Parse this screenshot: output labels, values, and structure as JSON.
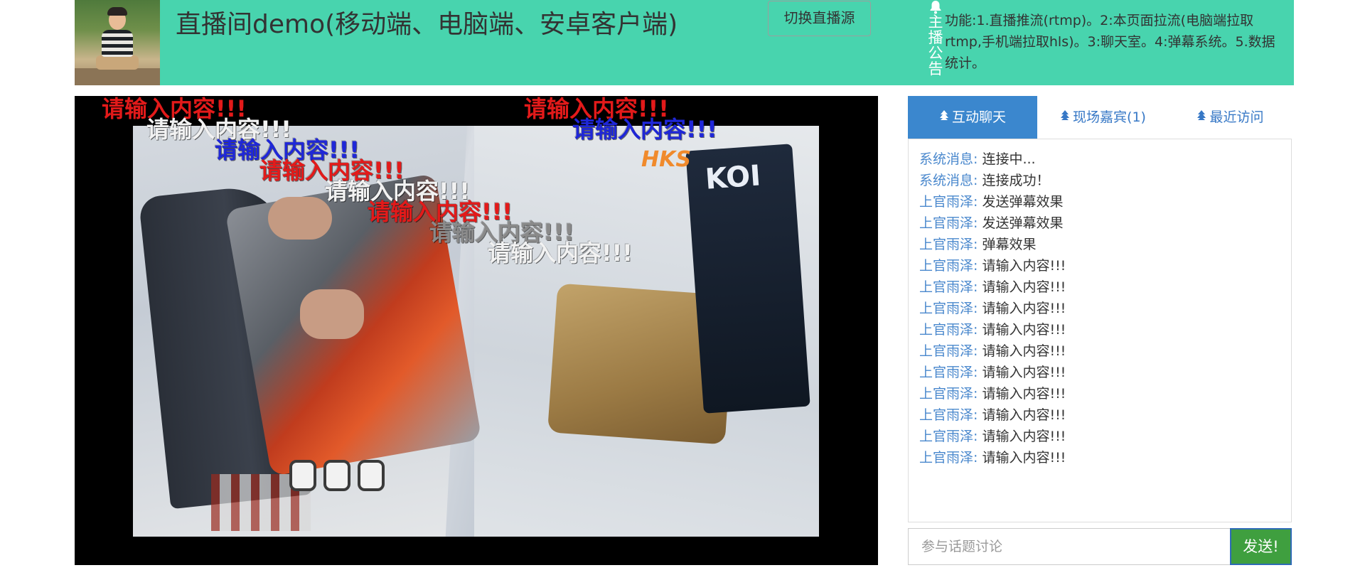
{
  "header": {
    "title": "直播间demo(移动端、电脑端、安卓客户端)",
    "switch_source_label": "切换直播源",
    "notice_label": "主播公告",
    "notice_text": "功能:1.直播推流(rtmp)。2:本页面拉流(电脑端拉取rtmp,手机端拉取hls)。3:聊天室。4:弹幕系统。5.数据统计。"
  },
  "colors": {
    "header_bg": "#48d4ae",
    "active_tab_bg": "#3b87ce",
    "link_blue": "#4a88cd",
    "send_button_bg": "#3f9f3f"
  },
  "video": {
    "danmu": [
      {
        "text": "请输入内容!!!",
        "color": "#e31a1a"
      },
      {
        "text": "请输入内容!!!",
        "color": "#e31a1a"
      },
      {
        "text": "请输入内容!!!",
        "color": "#f2f2f2"
      },
      {
        "text": "请输入内容!!!",
        "color": "#1f27d8"
      },
      {
        "text": "请输入内容!!!",
        "color": "#1f27d8"
      },
      {
        "text": "请输入内容!!!",
        "color": "#e31a1a"
      },
      {
        "text": "请输入内容!!!",
        "color": "#f2f2f2"
      },
      {
        "text": "请输入内容!!!",
        "color": "#e31a1a"
      },
      {
        "text": "请输入内容!!!",
        "color": "#8a8a8a"
      },
      {
        "text": "请输入内容!!!",
        "color": "#f2f2f2"
      }
    ],
    "frame_logo": "HKS",
    "frame_ad_text": "KOI"
  },
  "chat": {
    "tabs": [
      {
        "label": "互动聊天",
        "active": true
      },
      {
        "label": "现场嘉宾(1)",
        "active": false
      },
      {
        "label": "最近访问",
        "active": false
      }
    ],
    "messages": [
      {
        "user": "系统消息:",
        "text": "连接中..."
      },
      {
        "user": "系统消息:",
        "text": "连接成功！"
      },
      {
        "user": "上官雨泽:",
        "text": "发送弹幕效果"
      },
      {
        "user": "上官雨泽:",
        "text": "发送弹幕效果"
      },
      {
        "user": "上官雨泽:",
        "text": "弹幕效果"
      },
      {
        "user": "上官雨泽:",
        "text": "请输入内容!!!"
      },
      {
        "user": "上官雨泽:",
        "text": "请输入内容!!!"
      },
      {
        "user": "上官雨泽:",
        "text": "请输入内容!!!"
      },
      {
        "user": "上官雨泽:",
        "text": "请输入内容!!!"
      },
      {
        "user": "上官雨泽:",
        "text": "请输入内容!!!"
      },
      {
        "user": "上官雨泽:",
        "text": "请输入内容!!!"
      },
      {
        "user": "上官雨泽:",
        "text": "请输入内容!!!"
      },
      {
        "user": "上官雨泽:",
        "text": "请输入内容!!!"
      },
      {
        "user": "上官雨泽:",
        "text": "请输入内容!!!"
      },
      {
        "user": "上官雨泽:",
        "text": "请输入内容!!!"
      }
    ],
    "input_placeholder": "参与话题讨论",
    "send_label": "发送!"
  }
}
